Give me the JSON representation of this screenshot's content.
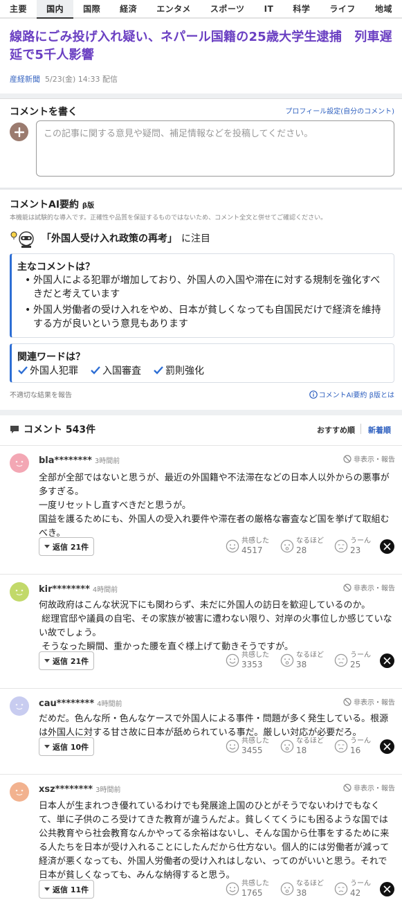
{
  "nav": {
    "tabs": [
      "主要",
      "国内",
      "国際",
      "経済",
      "エンタメ",
      "スポーツ",
      "IT",
      "科学",
      "ライフ",
      "地域"
    ],
    "active": "国内"
  },
  "article": {
    "title": "線路にごみ投げ入れ疑い、ネパール国籍の25歳大学生逮捕　列車遅延で5千人影響",
    "publisher": "産経新聞",
    "date": "5/23(金) 14:33 配信"
  },
  "write_comment": {
    "heading": "コメントを書く",
    "profile_link": "プロフィール設定(自分のコメント)",
    "placeholder": "この記事に関する意見や疑問、補足情報などを投稿してください。"
  },
  "ai_summary": {
    "heading": "コメントAI要約",
    "beta": "β版",
    "note": "本機能は試験的な導入です。正確性や品質を保証するものではないため、コメント全文と併せてご確認ください。",
    "topic": "「外国人受け入れ政策の再考」",
    "topic_suffix": "に注目",
    "main_heading": "主なコメントは？",
    "main_points": [
      "外国人による犯罪が増加しており、外国人の入国や滞在に対する規制を強化すべきだと考えています",
      "外国人労働者の受け入れをやめ、日本が貧しくなっても自国民だけで経済を維持する方が良いという意見もあります"
    ],
    "words_heading": "関連ワードは？",
    "words": [
      "外国人犯罪",
      "入国審査",
      "罰則強化"
    ],
    "report": "不適切な結果を報告",
    "about": "コメントAI要約 β版とは"
  },
  "comments_section": {
    "heading": "コメント 543件",
    "sort_recommended": "おすすめ順",
    "sort_newest": "新着順"
  },
  "reaction_labels": {
    "empathy": "共感した",
    "naruhodo": "なるほど",
    "uun": "うーん"
  },
  "hide_label": "非表示・報告",
  "comments": [
    {
      "user": "bla********",
      "time": "3時間前",
      "avatar_color": "#f3a7b4",
      "text": "全部が全部ではないと思うが、最近の外国籍や不法滞在などの日本人以外からの悪事が多すぎる。\n一度リセットし直すべきだと思うが。\n国益を護るためにも、外国人の受入れ要件や滞在者の厳格な審査など国を挙げて取組むべき。",
      "replies": "返信 21件",
      "empathy": "4517",
      "naruhodo": "28",
      "uun": "23"
    },
    {
      "user": "kir********",
      "time": "4時間前",
      "avatar_color": "#c2d96a",
      "text": "何故政府はこんな状況下にも関わらず、未だに外国人の訪日を歓迎しているのか。\n 総理官邸や議員の自宅、その家族が被害に遭わない限り、対岸の火事位しか感じていない故でしょう。\n そうなった瞬間、重かった腰を直ぐ様上げて動きそうですが。",
      "replies": "返信 21件",
      "empathy": "3353",
      "naruhodo": "38",
      "uun": "25"
    },
    {
      "user": "cau********",
      "time": "4時間前",
      "avatar_color": "#c8ccf0",
      "text": "だめだ。色んな所・色んなケースで外国人による事件・問題が多く発生している。根源は外国人に対する甘さ故に日本が舐められている事だ。厳しい対応が必要だろ。",
      "replies": "返信 10件",
      "empathy": "3455",
      "naruhodo": "18",
      "uun": "16"
    },
    {
      "user": "xsz********",
      "time": "3時間前",
      "avatar_color": "#f2b28f",
      "text": "日本人が生まれつき優れているわけでも発展途上国のひとがそうでないわけでもなくて、単に子供のころ受けてきた教育が違うんだよ。貧しくてくうにも困るような国では公共教育やら社会教育なんかやってる余裕はないし、そんな国から仕事をするために来る人たちを日本が受け入れることにしたんだから仕方ない。個人的には労働者が減って経済が悪くなっても、外国人労働者の受け入れはしない、ってのがいいと思う。それで日本が貧しくなっても、みんな納得すると思う。",
      "replies": "返信 11件",
      "empathy": "1765",
      "naruhodo": "38",
      "uun": "42"
    }
  ]
}
